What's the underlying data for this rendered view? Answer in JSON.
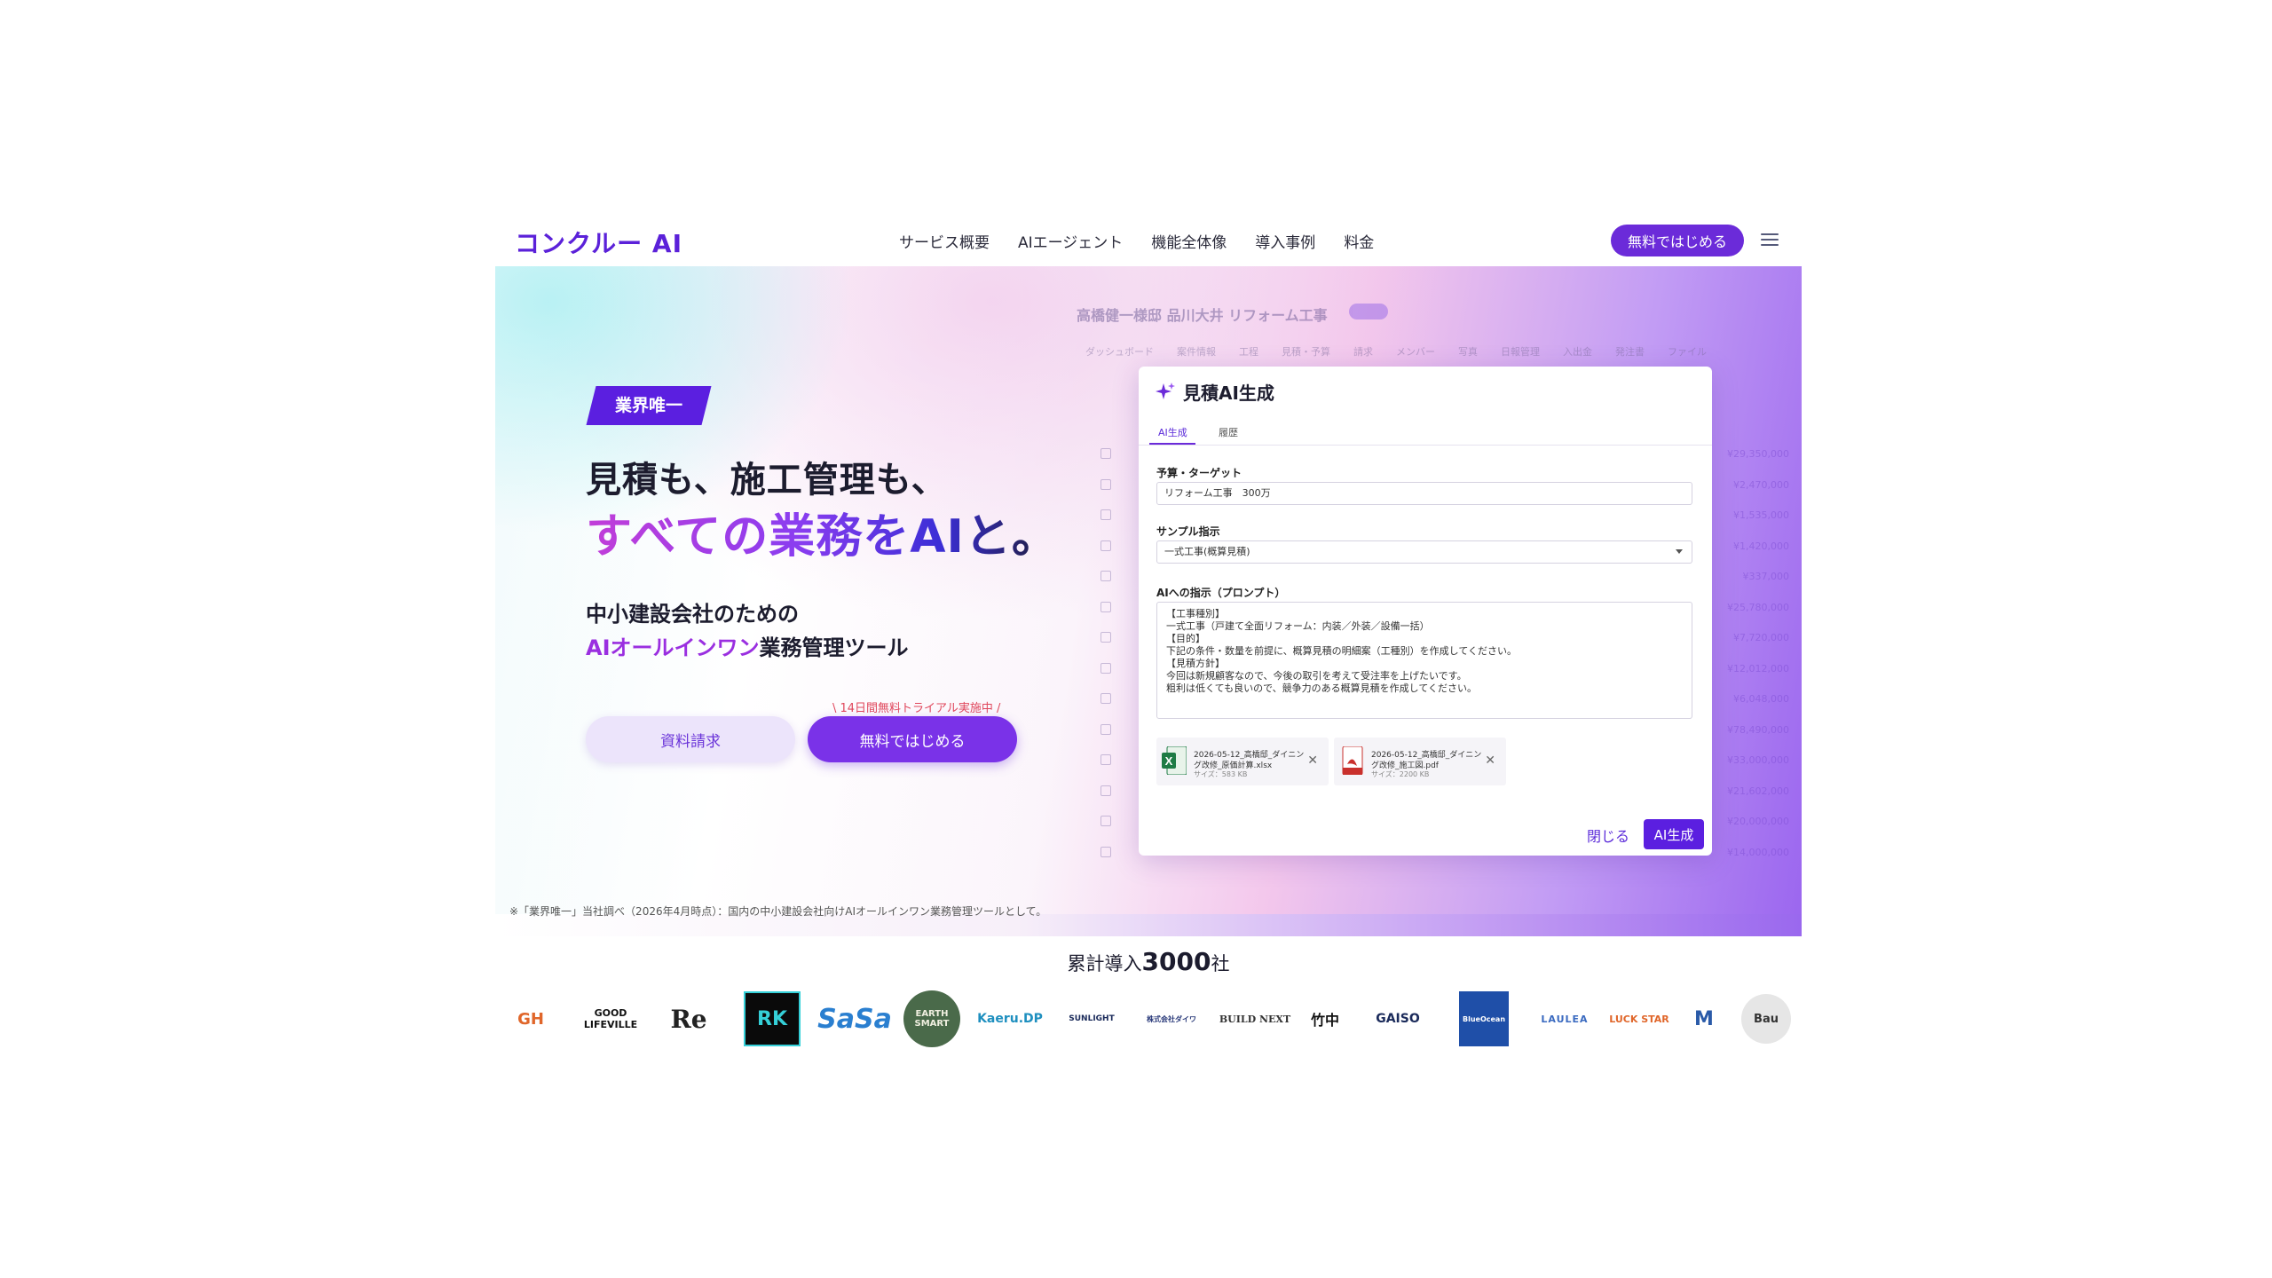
{
  "header": {
    "logo": "コンクルー AI",
    "nav": [
      "サービス概要",
      "AIエージェント",
      "機能全体像",
      "導入事例",
      "料金"
    ],
    "cta": "無料ではじめる"
  },
  "hero": {
    "badge": "業界唯一",
    "headline1": "見積も、施工管理も、",
    "headline2": "すべての業務をAIと。",
    "sub1": "中小建設会社のための",
    "sub2_accent": "AIオールインワン",
    "sub2_rest": "業務管理ツール",
    "trial_note": "\\ 14日間無料トライアル実施中 /",
    "btn_doc": "資料請求",
    "btn_free": "無料ではじめる",
    "footnote": "※「業界唯一」当社調べ（2026年4月時点）：国内の中小建設会社向けAIオールインワン業務管理ツールとして。"
  },
  "bg_app": {
    "title": "高橋健一様邸 品川大井 リフォーム工事",
    "tabs": [
      "ダッシュボード",
      "案件情報",
      "工程",
      "見積・予算",
      "請求",
      "メンバー",
      "写真",
      "日報管理",
      "入出金",
      "発注書",
      "ファイル"
    ],
    "amounts": [
      "¥29,350,000",
      "¥2,470,000",
      "¥1,535,000",
      "¥1,420,000",
      "¥337,000",
      "¥25,780,000",
      "¥7,720,000",
      "¥12,012,000",
      "¥6,048,000",
      "¥78,490,000",
      "¥33,000,000",
      "¥21,602,000",
      "¥20,000,000",
      "¥14,000,000"
    ]
  },
  "modal": {
    "title": "見積AI生成",
    "tabs": [
      "AI生成",
      "履歴"
    ],
    "budget_label": "予算・ターゲット",
    "budget_value": "リフォーム工事　300万",
    "sample_label": "サンプル指示",
    "sample_value": "一式工事(概算見積)",
    "prompt_label": "AIへの指示（プロンプト）",
    "prompt_lines": [
      "【工事種別】",
      "一式工事（戸建て全面リフォーム：内装／外装／設備一括）",
      "",
      "【目的】",
      "下記の条件・数量を前提に、概算見積の明細案（工種別）を作成してください。",
      "",
      "【見積方針】",
      "今回は新規顧客なので、今後の取引を考えて受注率を上げたいです。",
      "粗利は低くても良いので、競争力のある概算見積を作成してください。"
    ],
    "files": [
      {
        "name1": "2026-05-12_高橋邸_ダイニン",
        "name2": "グ改修_原価計算.xlsx",
        "size": "サイズ：583 KB",
        "icon": "excel-file-icon"
      },
      {
        "name1": "2026-05-12_高橋邸_ダイニン",
        "name2": "グ改修_施工図.pdf",
        "size": "サイズ：2200 KB",
        "icon": "pdf-file-icon"
      }
    ],
    "close": "閉じる",
    "generate": "AI生成"
  },
  "clients": {
    "title_pre": "累計導入",
    "title_num": "3000",
    "title_post": "社",
    "logos": [
      "GH",
      "GOOD LIFEVILLE",
      "Re",
      "RK",
      "SaSa",
      "EARTH SMART",
      "Kaeru.DP",
      "SUNLIGHT",
      "株式会社ダイワ",
      "BUILD NEXT",
      "竹中",
      "GAISO",
      "BlueOcean",
      "LAULEA",
      "LUCK STAR",
      "M",
      "Bau"
    ]
  },
  "colors": {
    "brand": "#5b21d9",
    "accent": "#7a32e8"
  }
}
